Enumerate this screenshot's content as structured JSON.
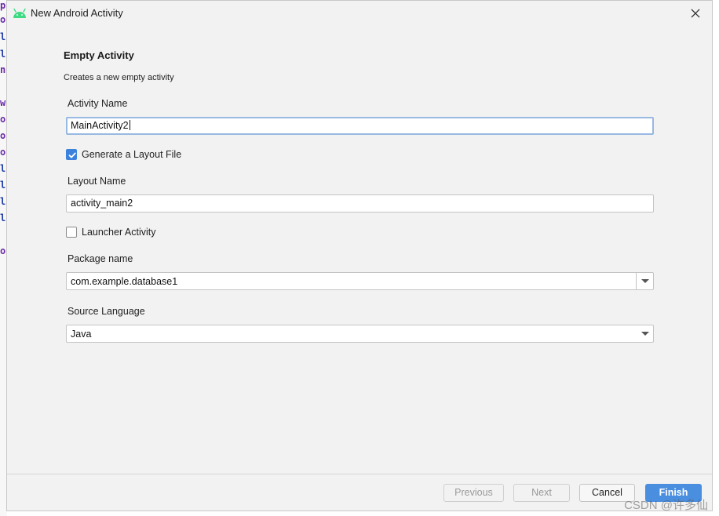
{
  "dialog": {
    "title": "New Android Activity",
    "icon": "android-icon",
    "close_icon": "close-icon"
  },
  "section": {
    "title": "Empty Activity",
    "description": "Creates a new empty activity"
  },
  "form": {
    "activity_name": {
      "label": "Activity Name",
      "value": "MainActivity2"
    },
    "generate_layout": {
      "label": "Generate a Layout File",
      "checked": true
    },
    "layout_name": {
      "label": "Layout Name",
      "value": "activity_main2"
    },
    "launcher_activity": {
      "label": "Launcher Activity",
      "checked": false
    },
    "package_name": {
      "label": "Package name",
      "value": "com.example.database1"
    },
    "source_language": {
      "label": "Source Language",
      "value": "Java"
    }
  },
  "buttons": {
    "previous": "Previous",
    "next": "Next",
    "cancel": "Cancel",
    "finish": "Finish"
  },
  "watermark": "CSDN @许多仙",
  "colors": {
    "accent": "#4a8ee0",
    "checkbox_checked": "#3c82dc",
    "android_green": "#3ddc84",
    "focus_border": "#98b9e2"
  }
}
